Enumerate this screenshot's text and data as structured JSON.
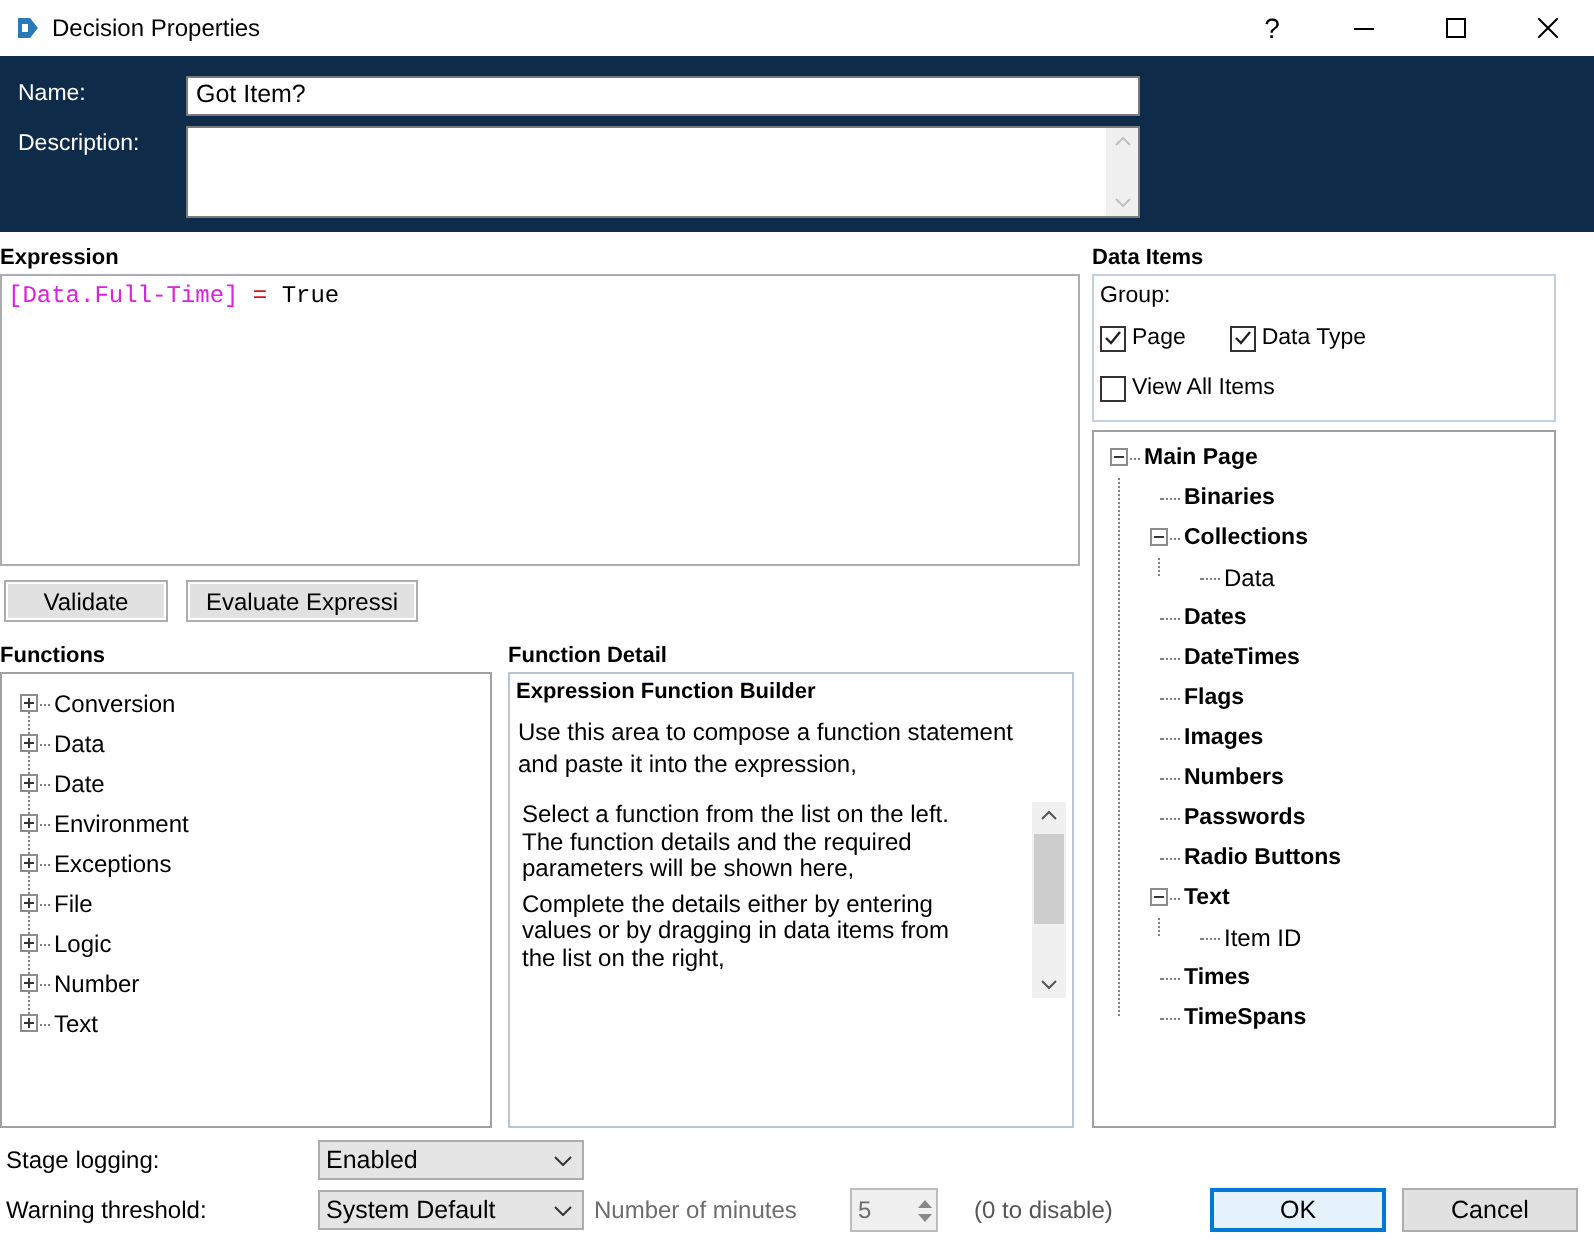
{
  "window": {
    "title": "Decision Properties",
    "help": "?"
  },
  "name_field": {
    "label": "Name:",
    "value": "Got Item?"
  },
  "description_field": {
    "label": "Description:"
  },
  "expression": {
    "label": "Expression",
    "tokens": [
      {
        "kind": "field",
        "text": "[Data.Full-Time]"
      },
      {
        "kind": "operator",
        "text": "="
      },
      {
        "kind": "literal",
        "text": "True"
      }
    ]
  },
  "expression_buttons": [
    "Validate",
    "Evaluate Expressi"
  ],
  "functions": {
    "label": "Functions",
    "items": [
      {
        "label": "Conversion",
        "expanded": false
      },
      {
        "label": "Data",
        "expanded": false
      },
      {
        "label": "Date",
        "expanded": false
      },
      {
        "label": "Environment",
        "expanded": false
      },
      {
        "label": "Exceptions",
        "expanded": false
      },
      {
        "label": "File",
        "expanded": false
      },
      {
        "label": "Logic",
        "expanded": false
      },
      {
        "label": "Number",
        "expanded": false
      },
      {
        "label": "Text",
        "expanded": false
      }
    ]
  },
  "function_detail": {
    "label": "Function Detail",
    "heading": "Expression Function Builder",
    "intro": "Use this area to compose a function statement and paste it into the expression,",
    "paragraphs": [
      "Select a function from the list on the left. The function details and the required parameters will be shown here,",
      "Complete the details either by entering values or by dragging in data items from the list on the right,"
    ]
  },
  "data_items": {
    "label": "Data Items",
    "group_label": "Group:",
    "options": [
      {
        "label": "Page",
        "checked": true
      },
      {
        "label": "Data Type",
        "checked": true
      },
      {
        "label": "View All Items",
        "checked": false
      }
    ],
    "tree": [
      {
        "label": "Main Page",
        "kind": "group",
        "expanded": true,
        "children": [
          {
            "label": "Binaries",
            "kind": "group"
          },
          {
            "label": "Collections",
            "kind": "group",
            "expanded": true,
            "children": [
              {
                "label": "Data",
                "kind": "item"
              }
            ]
          },
          {
            "label": "Dates",
            "kind": "group"
          },
          {
            "label": "DateTimes",
            "kind": "group"
          },
          {
            "label": "Flags",
            "kind": "group"
          },
          {
            "label": "Images",
            "kind": "group"
          },
          {
            "label": "Numbers",
            "kind": "group"
          },
          {
            "label": "Passwords",
            "kind": "group"
          },
          {
            "label": "Radio Buttons",
            "kind": "group"
          },
          {
            "label": "Text",
            "kind": "group",
            "expanded": true,
            "children": [
              {
                "label": "Item ID",
                "kind": "item"
              }
            ]
          },
          {
            "label": "Times",
            "kind": "group"
          },
          {
            "label": "TimeSpans",
            "kind": "group"
          }
        ]
      }
    ]
  },
  "stage_logging": {
    "label": "Stage logging:",
    "value": "Enabled"
  },
  "warning_threshold": {
    "label": "Warning threshold:",
    "value": "System Default",
    "minutes_label": "Number of minutes",
    "minutes": "5",
    "minutes_disabled": true,
    "hint": "(0 to disable)"
  },
  "buttons": [
    {
      "label": "OK",
      "default": true
    },
    {
      "label": "Cancel",
      "default": false
    }
  ]
}
